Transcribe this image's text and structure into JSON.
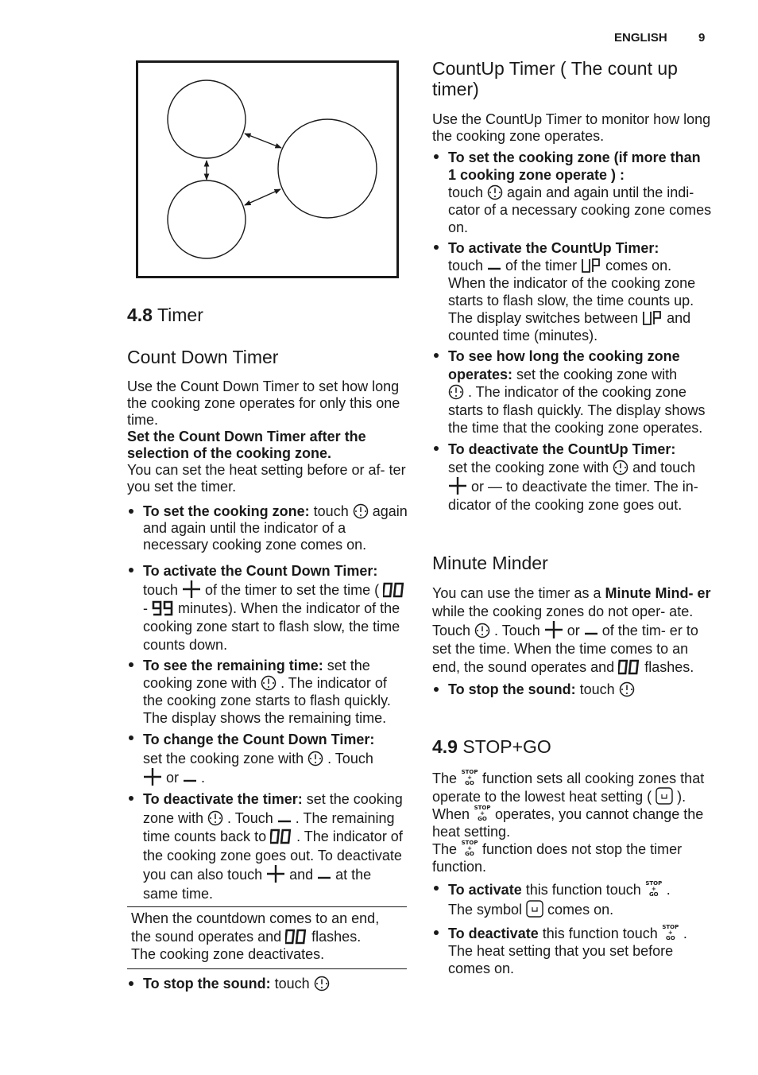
{
  "header": {
    "language": "ENGLISH",
    "page_number": "9"
  },
  "diagram": {
    "description": "Three cooking zones with double-headed arrows between them"
  },
  "left": {
    "section": {
      "number": "4.8",
      "title": "Timer"
    },
    "countdown": {
      "title": "Count Down Timer",
      "intro": "Use the Count Down Timer to set how long the cooking zone operates for only this one time.",
      "bold_note": "Set the Count Down Timer after the selection of the cooking zone.",
      "note": "You can set the heat setting before or af- ter you set the timer.",
      "bullets": [
        {
          "label": "To set the cooking zone:",
          "t1": " touch ",
          "t2": " again and again until the indicator of a necessary cooking zone comes on."
        },
        {
          "label": "To activate the Count Down Timer:",
          "t1": "touch ",
          "t2": " of the timer to set the time ( ",
          "d1": "00",
          "dash": " - ",
          "d2": "99",
          "t3": " minutes). When the indicator of the cooking zone start to flash slow, the time counts down."
        },
        {
          "label": "To see the remaining time:",
          "t1": " set the cooking zone with ",
          "t2": " . The indicator of the cooking zone starts to flash quickly. The display shows the remaining time."
        },
        {
          "label": "To change the Count Down Timer:",
          "t1": "set the cooking zone with ",
          "t2": " . Touch ",
          "t3": " or ",
          "t4": " ."
        },
        {
          "label": "To deactivate the timer:",
          "t1": " set the cooking zone with ",
          "t2": " . Touch ",
          "t3": " . The remaining time counts back to ",
          "d1": "00",
          "t4": " . The indicator of the cooking zone goes out. To deactivate you can also touch ",
          "t5": " and ",
          "t6": " at the same time."
        }
      ],
      "info_box": {
        "l1": "When the countdown comes to an end,",
        "l2a": "the sound operates and ",
        "d1": "00",
        "l2b": " flashes.",
        "l3": "The cooking zone deactivates."
      },
      "stop_sound": {
        "label": "To stop the sound:",
        "t1": " touch "
      }
    }
  },
  "right": {
    "countup": {
      "title": "CountUp Timer ( The count up timer)",
      "intro": "Use the CountUp Timer to monitor how long the cooking zone operates.",
      "bullets": [
        {
          "label": "To set the cooking zone (if more than 1 cooking zone operate ) :",
          "t1": "touch ",
          "t2": " again and again until the indi- cator of a necessary cooking zone comes on."
        },
        {
          "label": "To activate the CountUp Timer:",
          "t1": "touch ",
          "t2": " of the timer ",
          "up": "UP",
          "t3": " comes on. When the indicator of the cooking zone starts to flash slow, the time counts up.",
          "t4": "The display switches between ",
          "t5": " and counted time (minutes)."
        },
        {
          "label": "To see how long the cooking zone operates:",
          "t1": " set the cooking zone with ",
          "t2": " . The indicator of the cooking zone starts to flash quickly. The display shows the time that the cooking zone operates."
        },
        {
          "label": "To deactivate the CountUp Timer:",
          "t1": "set the cooking zone with ",
          "t2": " and touch ",
          "t3": " or — to deactivate the timer. The in- dicator of the cooking zone goes out."
        }
      ]
    },
    "minute_minder": {
      "title": "Minute Minder",
      "p1": "You can use the timer as a ",
      "p1b": "Minute Mind- er",
      "p2": " while the cooking zones do not oper- ate. Touch ",
      "p3": " . Touch ",
      "p4": " or ",
      "p5": " of the tim- er to set the time. When the time comes to an end, the sound operates and ",
      "d1": "00",
      "p6": " flashes.",
      "stop_sound": {
        "label": "To stop the sound:",
        "t1": " touch "
      }
    },
    "stopgo": {
      "section": {
        "number": "4.9",
        "title": "STOP+GO"
      },
      "symbol": {
        "top": "STOP",
        "mid": "+",
        "bot": "GO"
      },
      "p1a": "The ",
      "p1b": " function sets all cooking zones that operate to the lowest heat setting ( ",
      "p1c": " ).",
      "p2a": "When ",
      "p2b": " operates, you cannot change the heat setting.",
      "p3a": "The ",
      "p3b": " function does not stop the timer function.",
      "bullets": [
        {
          "label": "To activate",
          "t1": " this function touch ",
          "t2": " .",
          "t3": "The symbol ",
          "t4": " comes on."
        },
        {
          "label": "To deactivate",
          "t1": " this function touch ",
          "t2": " .",
          "t3": "The heat setting that you set before comes on."
        }
      ]
    }
  }
}
